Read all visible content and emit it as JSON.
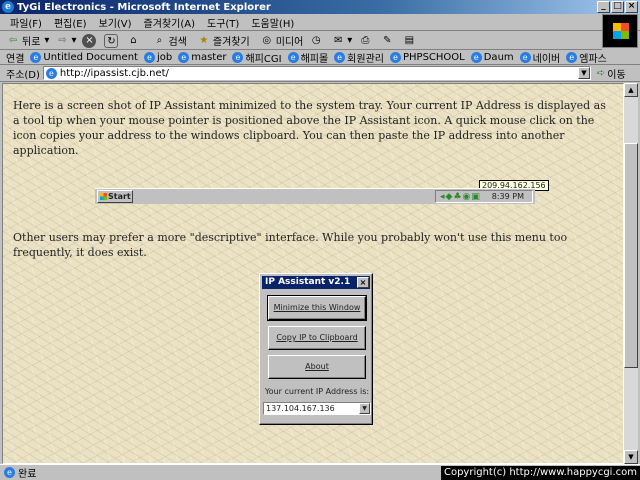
{
  "window": {
    "title": "TyGi Electronics - Microsoft Internet Explorer"
  },
  "menu": [
    "파일(F)",
    "편집(E)",
    "보기(V)",
    "즐겨찾기(A)",
    "도구(T)",
    "도움말(H)"
  ],
  "toolbar": {
    "back": "뒤로",
    "search": "검색",
    "favorites": "즐겨찾기",
    "media": "미디어"
  },
  "links": {
    "label": "연결",
    "items": [
      "Untitled Document",
      "job",
      "master",
      "해피CGI",
      "해피몰",
      "회원관리",
      "PHPSCHOOL",
      "Daum",
      "네이버",
      "엠파스"
    ]
  },
  "address": {
    "label": "주소(D)",
    "url": "http://ipassist.cjb.net/",
    "go": "이동"
  },
  "content": {
    "para1": "Here is a screen shot of IP Assistant minimized to the system tray.  Your current IP Address is displayed as a tool tip when your mouse pointer is positioned above the IP Assistant icon.  A quick mouse click on the icon copies your address to the windows clipboard.  You can then paste the IP address into another application.",
    "para2": "Other users may prefer a more \"descriptive\" interface.  While you probably won't use this menu too frequently, it does exist.",
    "taskbar": {
      "start": "Start",
      "tooltip_ip": "209.94.162.156",
      "clock": "8:39 PM"
    },
    "dialog": {
      "title": "IP Assistant  v2.1",
      "btn_minimize": "Minimize this Window",
      "btn_copy": "Copy IP to Clipboard",
      "btn_about": "About",
      "ip_label": "Your current IP Address is:",
      "ip_value": "137.104.167.136"
    }
  },
  "status": {
    "text": "완료",
    "copyright": "Copyright(c) http://www.happycgi.com"
  }
}
